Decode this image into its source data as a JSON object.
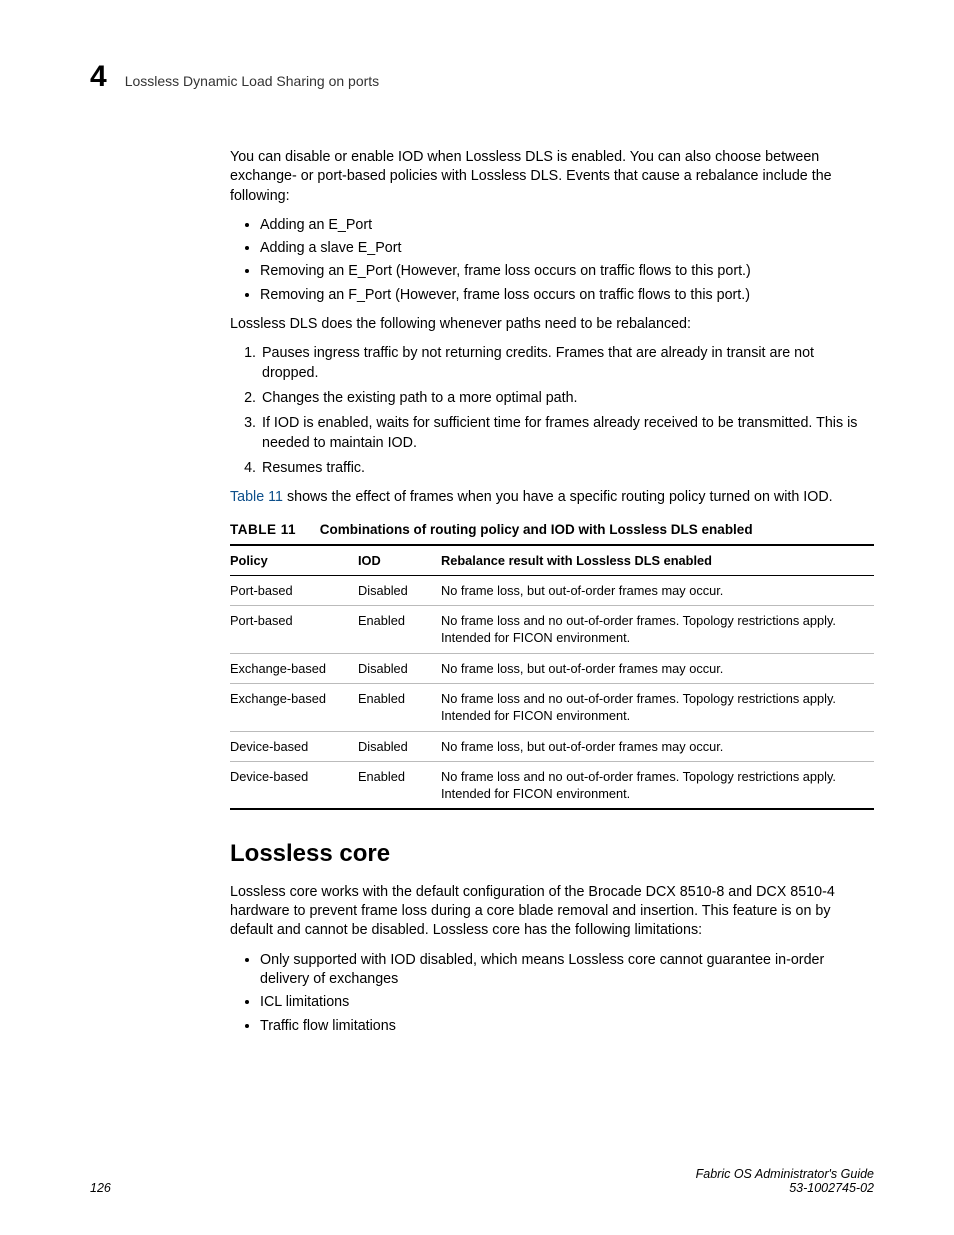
{
  "header": {
    "chapter_number": "4",
    "running_title": "Lossless Dynamic Load Sharing on ports"
  },
  "intro_para": "You can disable or enable IOD when Lossless DLS is enabled. You can also choose between exchange- or port-based policies with Lossless DLS. Events that cause a rebalance include the following:",
  "bullets1": [
    "Adding an E_Port",
    "Adding a slave E_Port",
    "Removing an E_Port (However, frame loss occurs on traffic flows to this port.)",
    "Removing an F_Port (However, frame loss occurs on traffic flows to this port.)"
  ],
  "para2": "Lossless DLS does the following whenever paths need to be rebalanced:",
  "steps": [
    "Pauses ingress traffic by not returning credits. Frames that are already in transit are not dropped.",
    "Changes the existing path to a more optimal path.",
    "If IOD is enabled, waits for sufficient time for frames already received to be transmitted. This is needed to maintain IOD.",
    "Resumes traffic."
  ],
  "xref_line": {
    "link": "Table 11",
    "rest": " shows the effect of frames when you have a specific routing policy turned on with IOD."
  },
  "table": {
    "label": "TABLE 11",
    "caption": "Combinations of routing policy and IOD with Lossless DLS enabled",
    "headers": [
      "Policy",
      "IOD",
      "Rebalance result with Lossless DLS enabled"
    ],
    "rows": [
      [
        "Port-based",
        "Disabled",
        "No frame loss, but out-of-order frames may occur."
      ],
      [
        "Port-based",
        "Enabled",
        "No frame loss and no out-of-order frames. Topology restrictions apply. Intended for FICON environment."
      ],
      [
        "Exchange-based",
        "Disabled",
        "No frame loss, but out-of-order frames may occur."
      ],
      [
        "Exchange-based",
        "Enabled",
        "No frame loss and no out-of-order frames. Topology restrictions apply. Intended for FICON environment."
      ],
      [
        "Device-based",
        "Disabled",
        "No frame loss, but out-of-order frames may occur."
      ],
      [
        "Device-based",
        "Enabled",
        "No frame loss and no out-of-order frames. Topology restrictions apply. Intended for FICON environment."
      ]
    ]
  },
  "section": {
    "heading": "Lossless core",
    "para": "Lossless core works with the default configuration of the Brocade DCX 8510-8 and DCX 8510-4 hardware to prevent frame loss during a core blade removal and insertion. This feature is on by default and cannot be disabled. Lossless core has the following limitations:",
    "bullets": [
      "Only supported with IOD disabled, which means Lossless core cannot guarantee in-order delivery of exchanges",
      "ICL limitations",
      "Traffic flow limitations"
    ]
  },
  "footer": {
    "page": "126",
    "book": "Fabric OS Administrator's Guide",
    "docnum": "53-1002745-02"
  }
}
